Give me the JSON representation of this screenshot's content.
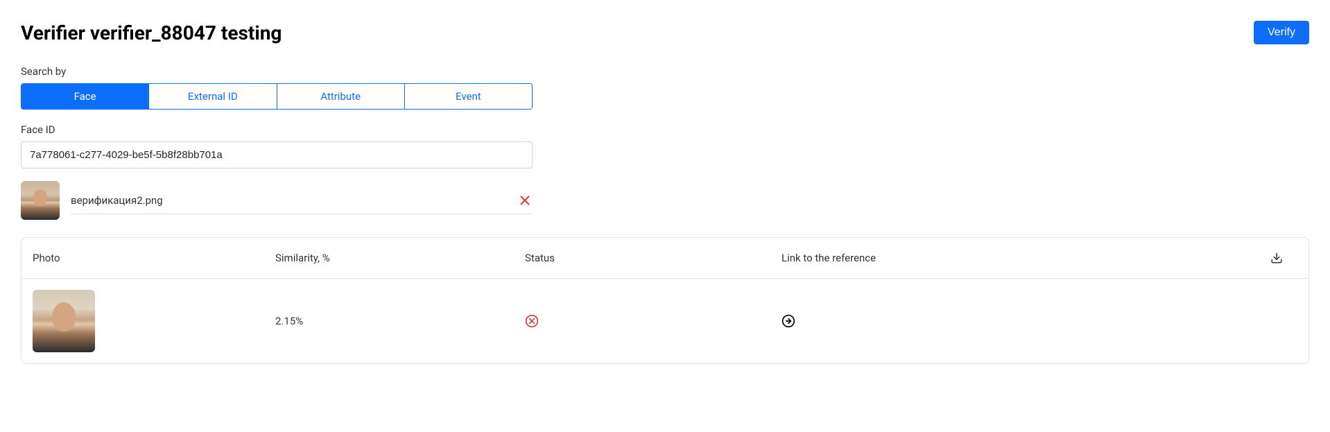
{
  "header": {
    "title": "Verifier verifier_88047 testing",
    "verify_button": "Verify"
  },
  "search": {
    "label": "Search by",
    "tabs": [
      {
        "label": "Face",
        "active": true
      },
      {
        "label": "External ID",
        "active": false
      },
      {
        "label": "Attribute",
        "active": false
      },
      {
        "label": "Event",
        "active": false
      }
    ]
  },
  "face_id": {
    "label": "Face ID",
    "value": "7a778061-c277-4029-be5f-5b8f28bb701a"
  },
  "uploaded_file": {
    "name": "верификация2.png"
  },
  "results": {
    "columns": {
      "photo": "Photo",
      "similarity": "Similarity, %",
      "status": "Status",
      "link": "Link to the reference"
    },
    "rows": [
      {
        "similarity": "2.15%",
        "status": "fail"
      }
    ]
  },
  "colors": {
    "primary": "#0d6efd",
    "danger": "#dc3545"
  }
}
